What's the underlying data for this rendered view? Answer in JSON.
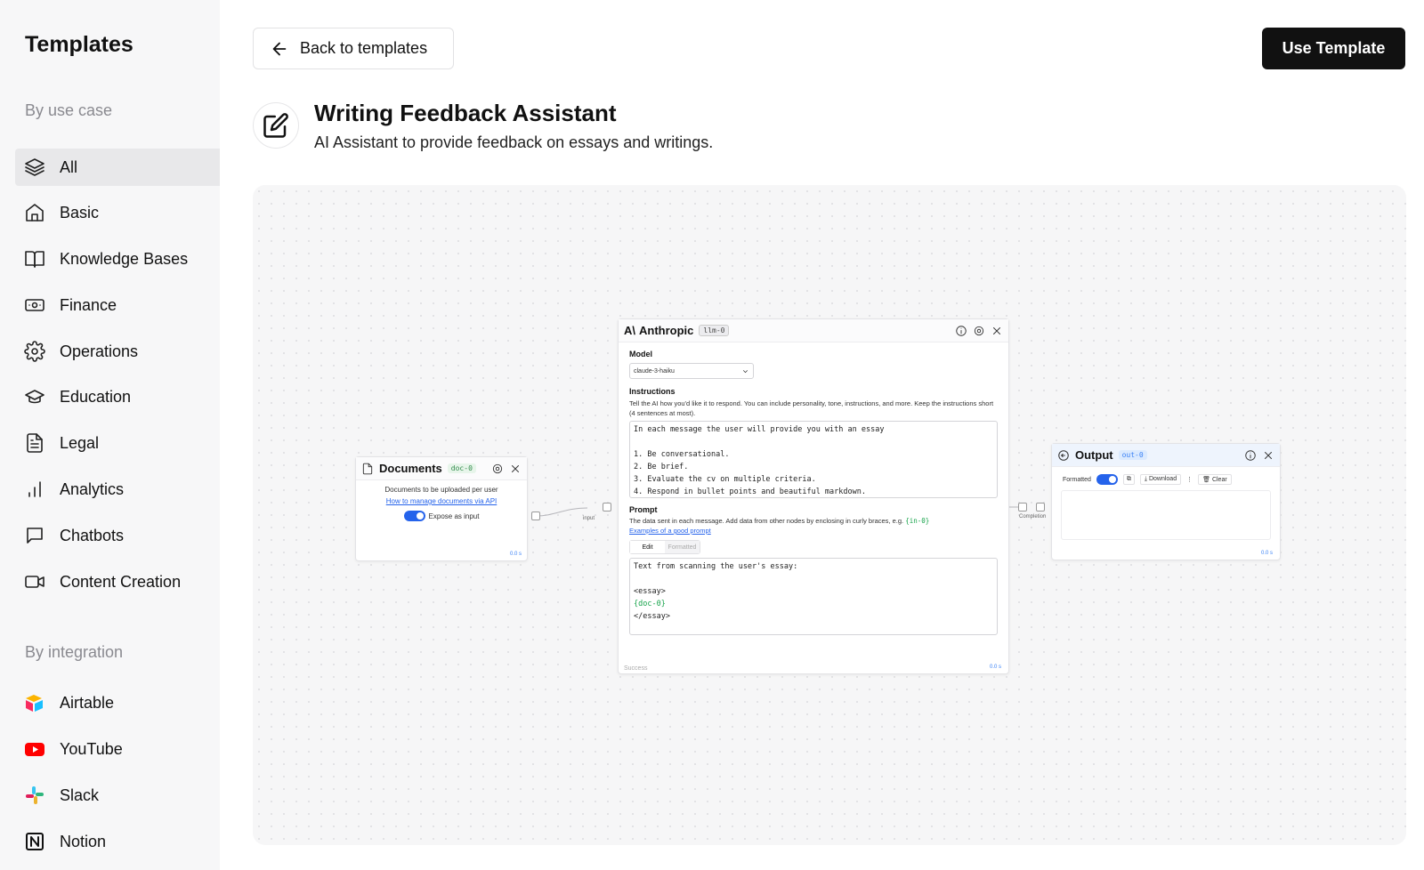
{
  "sidebar": {
    "title": "Templates",
    "use_case_label": "By use case",
    "integration_label": "By integration",
    "use_cases": [
      {
        "label": "All",
        "icon": "layers-icon",
        "active": true
      },
      {
        "label": "Basic",
        "icon": "home-icon"
      },
      {
        "label": "Knowledge Bases",
        "icon": "book-icon"
      },
      {
        "label": "Finance",
        "icon": "banknote-icon"
      },
      {
        "label": "Operations",
        "icon": "gear-icon"
      },
      {
        "label": "Education",
        "icon": "graduation-cap-icon"
      },
      {
        "label": "Legal",
        "icon": "document-icon"
      },
      {
        "label": "Analytics",
        "icon": "bar-chart-icon"
      },
      {
        "label": "Chatbots",
        "icon": "chat-bubble-icon"
      },
      {
        "label": "Content Creation",
        "icon": "video-camera-icon"
      }
    ],
    "integrations": [
      {
        "label": "Airtable",
        "icon": "airtable-logo-icon"
      },
      {
        "label": "YouTube",
        "icon": "youtube-logo-icon"
      },
      {
        "label": "Slack",
        "icon": "slack-logo-icon"
      },
      {
        "label": "Notion",
        "icon": "notion-logo-icon"
      }
    ]
  },
  "header": {
    "back_label": "Back to templates",
    "use_template_label": "Use Template",
    "title": "Writing Feedback Assistant",
    "subtitle": "AI Assistant to provide feedback on essays and writings."
  },
  "flow": {
    "documents": {
      "name": "Documents",
      "tag": "doc-0",
      "desc": "Documents to be uploaded per user",
      "link": "How to manage documents via API",
      "toggle_label": "Expose as input",
      "timer": "0.0 s"
    },
    "edge_input_label": "input",
    "edge_completion_label": "Completion",
    "anthropic": {
      "name": "Anthropic",
      "tag": "llm-0",
      "model_label": "Model",
      "model_value": "claude-3-haiku",
      "instructions_label": "Instructions",
      "instructions_help": "Tell the AI how you'd like it to respond. You can include personality, tone, instructions, and more. Keep the instructions short (4 sentences at most).",
      "instructions_text": "In each message the user will provide you with an essay\n\n1. Be conversational.\n2. Be brief.\n3. Evaluate the cv on multiple criteria.\n4. Respond in bullet points and beautiful markdown.",
      "prompt_label": "Prompt",
      "prompt_help": "The data sent in each message. Add data from other nodes by enclosing in curly braces, e.g.",
      "prompt_help_var": "{in-0}",
      "prompt_link": "Examples of a good prompt",
      "tab_edit": "Edit",
      "tab_formatted": "Formatted",
      "prompt_line1": "Text from scanning the user's essay:",
      "prompt_line2": "<essay>",
      "prompt_line3": "{doc-0}",
      "prompt_line4": "</essay>",
      "status": "Success",
      "timer": "0.0 s"
    },
    "output": {
      "name": "Output",
      "tag": "out-0",
      "formatted_label": "Formatted",
      "download_label": "Download",
      "clear_label": "Clear",
      "timer": "0.0 s"
    }
  },
  "colors": {
    "accent": "#2563eb",
    "primary_button": "#111111",
    "sidebar_bg": "#f7f7f8",
    "active_item_bg": "#e8e8ea"
  }
}
